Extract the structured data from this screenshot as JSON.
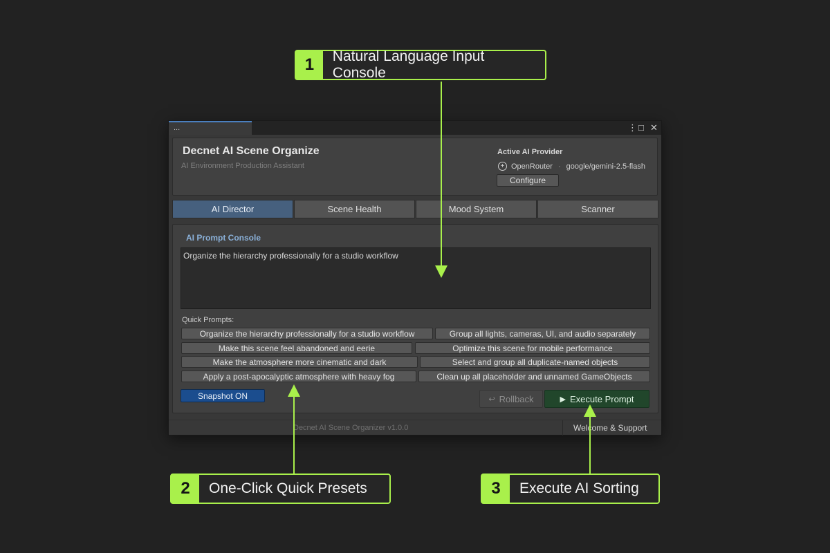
{
  "callouts": [
    {
      "number": "1",
      "label": "Natural Language Input Console"
    },
    {
      "number": "2",
      "label": "One-Click Quick Presets"
    },
    {
      "number": "3",
      "label": "Execute AI Sorting"
    }
  ],
  "colors": {
    "accent": "#a9f04b",
    "background": "#222222",
    "active_tab": "#46607e",
    "snapshot_button": "#1b4d8e",
    "execute_button": "#21462b"
  },
  "window": {
    "tab_label": "...",
    "controls": {
      "menu_icon": "⋮",
      "maximize_icon": "□",
      "close_icon": "✕"
    }
  },
  "header": {
    "title": "Decnet AI Scene Organize",
    "subtitle": "AI Environment Production Assistant",
    "provider_title": "Active AI Provider",
    "provider_icon": "plus-circle-icon",
    "provider_name": "OpenRouter",
    "provider_separator": "·",
    "model": "google/gemini-2.5-flash",
    "configure_label": "Configure"
  },
  "tabs": [
    {
      "label": "AI Director",
      "active": true
    },
    {
      "label": "Scene Health",
      "active": false
    },
    {
      "label": "Mood System",
      "active": false
    },
    {
      "label": "Scanner",
      "active": false
    }
  ],
  "console": {
    "title": "AI Prompt Console",
    "prompt_value": "Organize the hierarchy professionally for a studio workflow"
  },
  "quick_prompts": {
    "label": "Quick Prompts:",
    "items": [
      "Organize the hierarchy professionally for a studio workflow",
      "Group all lights, cameras, UI, and audio separately",
      "Make this scene feel abandoned and eerie",
      "Optimize this scene for mobile performance",
      "Make the atmosphere more cinematic and dark",
      "Select and group all duplicate-named objects",
      "Apply a post-apocalyptic atmosphere with heavy fog",
      "Clean up all placeholder and unnamed GameObjects"
    ]
  },
  "actions": {
    "snapshot_label": "Snapshot ON",
    "rollback_icon": "↩",
    "rollback_label": "Rollback",
    "execute_icon": "▶",
    "execute_label": "Execute Prompt"
  },
  "footer": {
    "version_text": "Decnet AI Scene Organizer  v1.0.0",
    "welcome_label": "Welcome & Support"
  }
}
